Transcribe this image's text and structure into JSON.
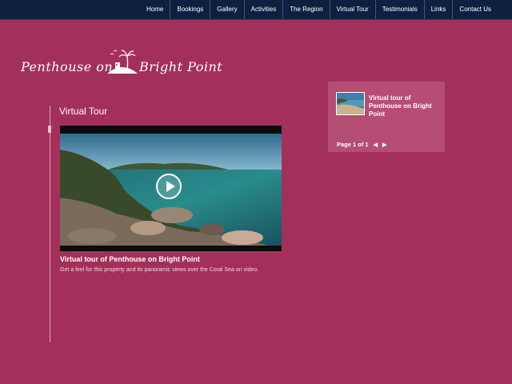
{
  "nav": {
    "items": [
      "Home",
      "Bookings",
      "Gallery",
      "Activities",
      "The Region",
      "Virtual Tour",
      "Testimonials",
      "Links",
      "Contact Us"
    ]
  },
  "logo": {
    "left_text": "Penthouse on",
    "right_text": "Bright Point"
  },
  "main": {
    "section_title": "Virtual Tour",
    "video_title": "Virtual tour of Penthouse on Bright Point",
    "video_description": "Get a feel for this property and its panoramic views over the Coral Sea on video."
  },
  "side": {
    "link_text": "Virtual tour of Penthouse on Bright Point",
    "pager_text": "Page 1 of 1",
    "prev_icon": "triangle-left-icon",
    "next_icon": "triangle-right-icon"
  },
  "colors": {
    "background": "#a3305a",
    "topbar": "#0e2040",
    "panel": "#b54d74"
  }
}
